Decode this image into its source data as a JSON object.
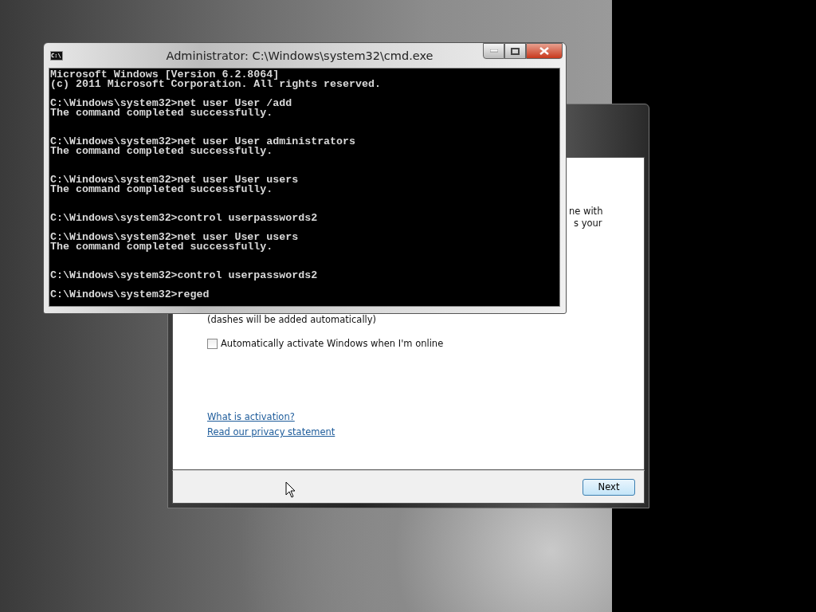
{
  "setup_window": {
    "partial_lines": [
      "ne with",
      "s your"
    ],
    "hint": "(dashes will be added automatically)",
    "checkbox": {
      "label": "Automatically activate Windows when I'm online",
      "checked": false
    },
    "links": [
      "What is activation?",
      "Read our privacy statement"
    ],
    "next_button": "Next"
  },
  "cmd_window": {
    "title": "Administrator: C:\\Windows\\system32\\cmd.exe",
    "icon_text": "C:\\.",
    "lines": [
      {
        "kind": "output",
        "text": "Microsoft Windows [Version 6.2.8064]"
      },
      {
        "kind": "output",
        "text": "(c) 2011 Microsoft Corporation. All rights reserved."
      },
      {
        "kind": "blank"
      },
      {
        "kind": "output",
        "text": "C:\\Windows\\system32>net user User /add"
      },
      {
        "kind": "output",
        "text": "The command completed successfully."
      },
      {
        "kind": "blank"
      },
      {
        "kind": "blank"
      },
      {
        "kind": "output",
        "text": "C:\\Windows\\system32>net user User administrators"
      },
      {
        "kind": "output",
        "text": "The command completed successfully."
      },
      {
        "kind": "blank"
      },
      {
        "kind": "blank"
      },
      {
        "kind": "output",
        "text": "C:\\Windows\\system32>net user User users"
      },
      {
        "kind": "output",
        "text": "The command completed successfully."
      },
      {
        "kind": "blank"
      },
      {
        "kind": "blank"
      },
      {
        "kind": "output",
        "text": "C:\\Windows\\system32>control userpasswords2"
      },
      {
        "kind": "blank"
      },
      {
        "kind": "output",
        "text": "C:\\Windows\\system32>net user User users"
      },
      {
        "kind": "output",
        "text": "The command completed successfully."
      },
      {
        "kind": "blank"
      },
      {
        "kind": "blank"
      },
      {
        "kind": "output",
        "text": "C:\\Windows\\system32>control userpasswords2"
      },
      {
        "kind": "blank"
      },
      {
        "kind": "output",
        "text": "C:\\Windows\\system32>reged"
      }
    ]
  }
}
